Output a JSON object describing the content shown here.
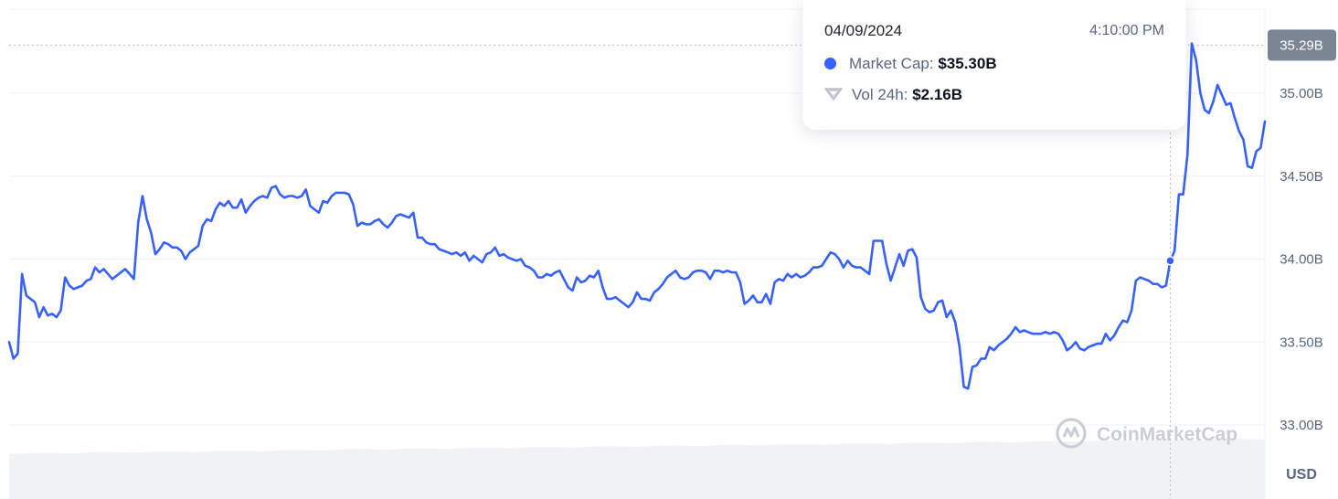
{
  "chart_data": {
    "type": "line",
    "currency_label": "USD",
    "y_ticks": [
      "35.00B",
      "34.50B",
      "34.00B",
      "33.50B",
      "33.00B"
    ],
    "y_tick_values": [
      35.0,
      34.5,
      34.0,
      33.5,
      33.0
    ],
    "ylim": [
      33.0,
      35.3
    ],
    "current_value_label": "35.29B",
    "current_value": 35.29,
    "grid": "horizontal",
    "watermark": "CoinMarketCap",
    "line_color": "#3861fb",
    "series": [
      {
        "values": [
          33.5,
          33.4,
          33.43,
          33.91,
          33.78,
          33.76,
          33.74,
          33.65,
          33.71,
          33.66,
          33.67,
          33.65,
          33.69,
          33.89,
          33.84,
          33.82,
          33.83,
          33.84,
          33.87,
          33.88,
          33.95,
          33.92,
          33.94,
          33.91,
          33.88,
          33.9,
          33.92,
          33.94,
          33.91,
          33.88,
          34.22,
          34.38,
          34.24,
          34.16,
          34.03,
          34.06,
          34.1,
          34.09,
          34.07,
          34.07,
          34.05,
          34.0,
          34.04,
          34.06,
          34.08,
          34.2,
          34.24,
          34.23,
          34.3,
          34.34,
          34.32,
          34.35,
          34.31,
          34.31,
          34.36,
          34.28,
          34.32,
          34.35,
          34.37,
          34.38,
          34.37,
          34.43,
          34.44,
          34.39,
          34.37,
          34.38,
          34.38,
          34.37,
          34.38,
          34.42,
          34.32,
          34.3,
          34.28,
          34.35,
          34.34,
          34.38,
          34.4,
          34.4,
          34.4,
          34.39,
          34.33,
          34.2,
          34.22,
          34.21,
          34.21,
          34.23,
          34.24,
          34.21,
          34.19,
          34.22,
          34.26,
          34.27,
          34.26,
          34.25,
          34.28,
          34.13,
          34.13,
          34.1,
          34.09,
          34.09,
          34.06,
          34.05,
          34.04,
          34.03,
          34.04,
          34.02,
          34.04,
          33.99,
          34.02,
          34.0,
          33.98,
          34.03,
          34.04,
          34.07,
          34.02,
          34.03,
          34.01,
          34.0,
          33.99,
          34.0,
          33.96,
          33.95,
          33.93,
          33.89,
          33.89,
          33.91,
          33.9,
          33.92,
          33.93,
          33.88,
          33.83,
          33.81,
          33.89,
          33.86,
          33.87,
          33.9,
          33.89,
          33.93,
          33.83,
          33.76,
          33.76,
          33.77,
          33.75,
          33.73,
          33.71,
          33.74,
          33.8,
          33.76,
          33.76,
          33.75,
          33.8,
          33.82,
          33.85,
          33.89,
          33.91,
          33.93,
          33.89,
          33.88,
          33.89,
          33.92,
          33.93,
          33.93,
          33.92,
          33.88,
          33.93,
          33.93,
          33.92,
          33.93,
          33.92,
          33.92,
          33.86,
          33.73,
          33.75,
          33.78,
          33.74,
          33.74,
          33.79,
          33.73,
          33.86,
          33.88,
          33.87,
          33.91,
          33.89,
          33.91,
          33.89,
          33.9,
          33.92,
          33.95,
          33.95,
          33.96,
          34.0,
          34.04,
          34.03,
          34.0,
          33.95,
          33.99,
          33.96,
          33.95,
          33.95,
          33.93,
          33.91,
          34.11,
          34.11,
          34.11,
          33.97,
          33.87,
          33.95,
          34.03,
          33.96,
          34.05,
          34.06,
          34.01,
          33.77,
          33.7,
          33.68,
          33.69,
          33.74,
          33.75,
          33.65,
          33.69,
          33.62,
          33.47,
          33.23,
          33.22,
          33.35,
          33.36,
          33.4,
          33.4,
          33.47,
          33.45,
          33.48,
          33.5,
          33.52,
          33.55,
          33.59,
          33.56,
          33.57,
          33.56,
          33.55,
          33.55,
          33.55,
          33.56,
          33.55,
          33.56,
          33.55,
          33.51,
          33.45,
          33.47,
          33.5,
          33.46,
          33.45,
          33.47,
          33.48,
          33.49,
          33.49,
          33.55,
          33.51,
          33.54,
          33.59,
          33.63,
          33.62,
          33.69,
          33.87,
          33.89,
          33.88,
          33.87,
          33.85,
          33.85,
          33.83,
          33.84,
          33.99,
          34.05,
          34.39,
          34.39,
          34.63,
          35.3,
          35.2,
          35.0,
          34.9,
          34.88,
          34.95,
          35.05,
          34.99,
          34.93,
          34.94,
          34.85,
          34.77,
          34.72,
          34.56,
          34.55,
          34.65,
          34.67,
          34.83
        ]
      }
    ],
    "crosshair_index": 270
  },
  "tooltip": {
    "date": "04/09/2024",
    "time": "4:10:00 PM",
    "market_cap_label": "Market Cap:",
    "market_cap_value": "$35.30B",
    "vol_label": "Vol 24h:",
    "vol_value": "$2.16B"
  }
}
